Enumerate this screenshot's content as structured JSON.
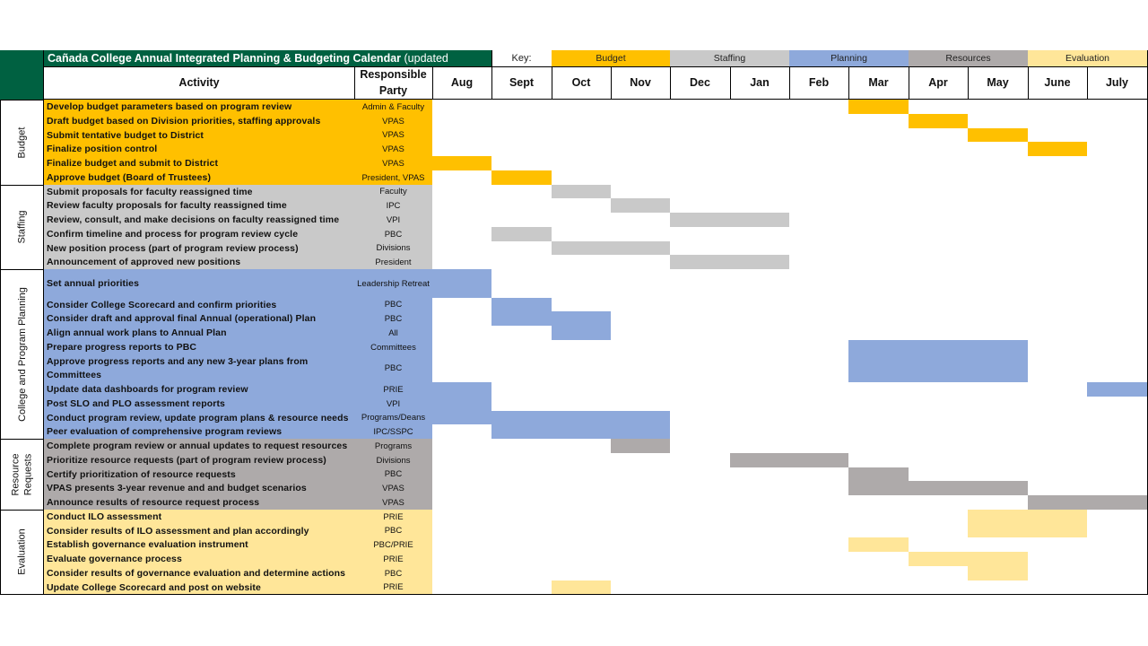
{
  "title": {
    "bold": "Cañada College Annual Integrated Planning & Budgeting Calendar",
    "normal": " (updated"
  },
  "key": {
    "label": "Key:",
    "items": [
      {
        "label": "Budget",
        "color": "#FFC000"
      },
      {
        "label": "Staffing",
        "color": "#C9C9C9"
      },
      {
        "label": "Planning",
        "color": "#8EA9DB"
      },
      {
        "label": "Resources",
        "color": "#AEAAAA"
      },
      {
        "label": "Evaluation",
        "color": "#FFE699"
      }
    ]
  },
  "colors": {
    "header_green": "#006141",
    "budget": "#FFC000",
    "staffing": "#C9C9C9",
    "planning": "#8EA9DB",
    "resources": "#AEAAAA",
    "evaluation": "#FFE699"
  },
  "headers": {
    "activity": "Activity",
    "party": "Responsible Party",
    "months": [
      "Aug",
      "Sept",
      "Oct",
      "Nov",
      "Dec",
      "Jan",
      "Feb",
      "Mar",
      "Apr",
      "May",
      "June",
      "July"
    ]
  },
  "sections": [
    {
      "name": "Budget",
      "color_key": "budget",
      "rows": [
        {
          "activity": "Develop budget parameters based on program review",
          "party": "Admin & Faculty",
          "months": [
            "Mar"
          ]
        },
        {
          "activity": "Draft budget based on Division priorities, staffing approvals",
          "party": "VPAS",
          "months": [
            "Apr"
          ]
        },
        {
          "activity": "Submit tentative budget to District",
          "party": "VPAS",
          "months": [
            "May"
          ]
        },
        {
          "activity": "Finalize position control",
          "party": "VPAS",
          "months": [
            "June"
          ]
        },
        {
          "activity": "Finalize budget and submit to District",
          "party": "VPAS",
          "months": [
            "Aug"
          ]
        },
        {
          "activity": "Approve budget (Board of Trustees)",
          "party": "President, VPAS",
          "months": [
            "Sept"
          ]
        }
      ]
    },
    {
      "name": "Staffing",
      "color_key": "staffing",
      "rows": [
        {
          "activity": "Submit proposals for faculty reassigned time",
          "party": "Faculty",
          "months": [
            "Oct"
          ]
        },
        {
          "activity": "Review faculty proposals for faculty reassigned time",
          "party": "IPC",
          "months": [
            "Nov"
          ]
        },
        {
          "activity": "Review, consult, and make decisions on faculty reassigned time",
          "party": "VPI",
          "months": [
            "Dec",
            "Jan"
          ]
        },
        {
          "activity": "Confirm timeline and process for program review cycle",
          "party": "PBC",
          "months": [
            "Sept"
          ]
        },
        {
          "activity": "New position process (part of program review process)",
          "party": "Divisions",
          "months": [
            "Oct",
            "Nov"
          ]
        },
        {
          "activity": "Announcement of approved new positions",
          "party": "President",
          "months": [
            "Dec",
            "Jan"
          ]
        }
      ]
    },
    {
      "name": "College and Program Planning",
      "color_key": "planning",
      "rows": [
        {
          "activity": "Set annual priorities",
          "party": "Leadership Retreat",
          "months": [
            "Aug"
          ],
          "tall": true
        },
        {
          "activity": "Consider College Scorecard and confirm priorities",
          "party": "PBC",
          "months": [
            "Sept"
          ]
        },
        {
          "activity": "Consider draft and approval final Annual (operational) Plan",
          "party": "PBC",
          "months": [
            "Sept",
            "Oct"
          ]
        },
        {
          "activity": "Align annual work plans to Annual Plan",
          "party": "All",
          "months": [
            "Oct"
          ]
        },
        {
          "activity": "Prepare progress reports to PBC",
          "party": "Committees",
          "months": [
            "Mar",
            "Apr",
            "May"
          ]
        },
        {
          "activity": "Approve progress reports and any new 3-year plans from Committees",
          "party": "PBC",
          "months": [
            "Mar",
            "Apr",
            "May"
          ],
          "tall": true
        },
        {
          "activity": "Update data dashboards for program review",
          "party": "PRIE",
          "months": [
            "Aug",
            "July"
          ]
        },
        {
          "activity": "Post SLO and PLO assessment reports",
          "party": "VPI",
          "months": [
            "Aug"
          ]
        },
        {
          "activity": "Conduct program review, update program plans & resource needs",
          "party": "Programs/Deans",
          "months": [
            "Aug",
            "Sept",
            "Oct",
            "Nov"
          ]
        },
        {
          "activity": "Peer evaluation of comprehensive program reviews",
          "party": "IPC/SSPC",
          "months": [
            "Sept",
            "Oct",
            "Nov"
          ]
        }
      ]
    },
    {
      "name": "Resource Requests",
      "color_key": "resources",
      "rows": [
        {
          "activity": "Complete program review or annual updates to request resources",
          "party": "Programs",
          "months": [
            "Nov"
          ]
        },
        {
          "activity": "Prioritize resource requests (part of program review process)",
          "party": "Divisions",
          "months": [
            "Jan",
            "Feb"
          ]
        },
        {
          "activity": "Certify prioritization of resource requests",
          "party": "PBC",
          "months": [
            "Mar"
          ]
        },
        {
          "activity": "VPAS presents 3-year revenue and and budget scenarios",
          "party": "VPAS",
          "months": [
            "Mar",
            "Apr",
            "May"
          ]
        },
        {
          "activity": "Announce results of resource request process",
          "party": "VPAS",
          "months": [
            "June",
            "July"
          ]
        }
      ]
    },
    {
      "name": "Evaluation",
      "color_key": "evaluation",
      "rows": [
        {
          "activity": "Conduct ILO assessment",
          "party": "PRIE",
          "months": [
            "May",
            "June"
          ]
        },
        {
          "activity": "Consider results of ILO assessment and plan accordingly",
          "party": "PBC",
          "months": [
            "May",
            "June"
          ]
        },
        {
          "activity": "Establish governance evaluation instrument",
          "party": "PBC/PRIE",
          "months": [
            "Mar"
          ]
        },
        {
          "activity": "Evaluate governance process",
          "party": "PRIE",
          "months": [
            "Apr",
            "May"
          ]
        },
        {
          "activity": "Consider results of governance evaluation and determine actions",
          "party": "PBC",
          "months": [
            "May"
          ]
        },
        {
          "activity": "Update College Scorecard and post on website",
          "party": "PRIE",
          "months": [
            "Oct"
          ]
        }
      ]
    }
  ]
}
